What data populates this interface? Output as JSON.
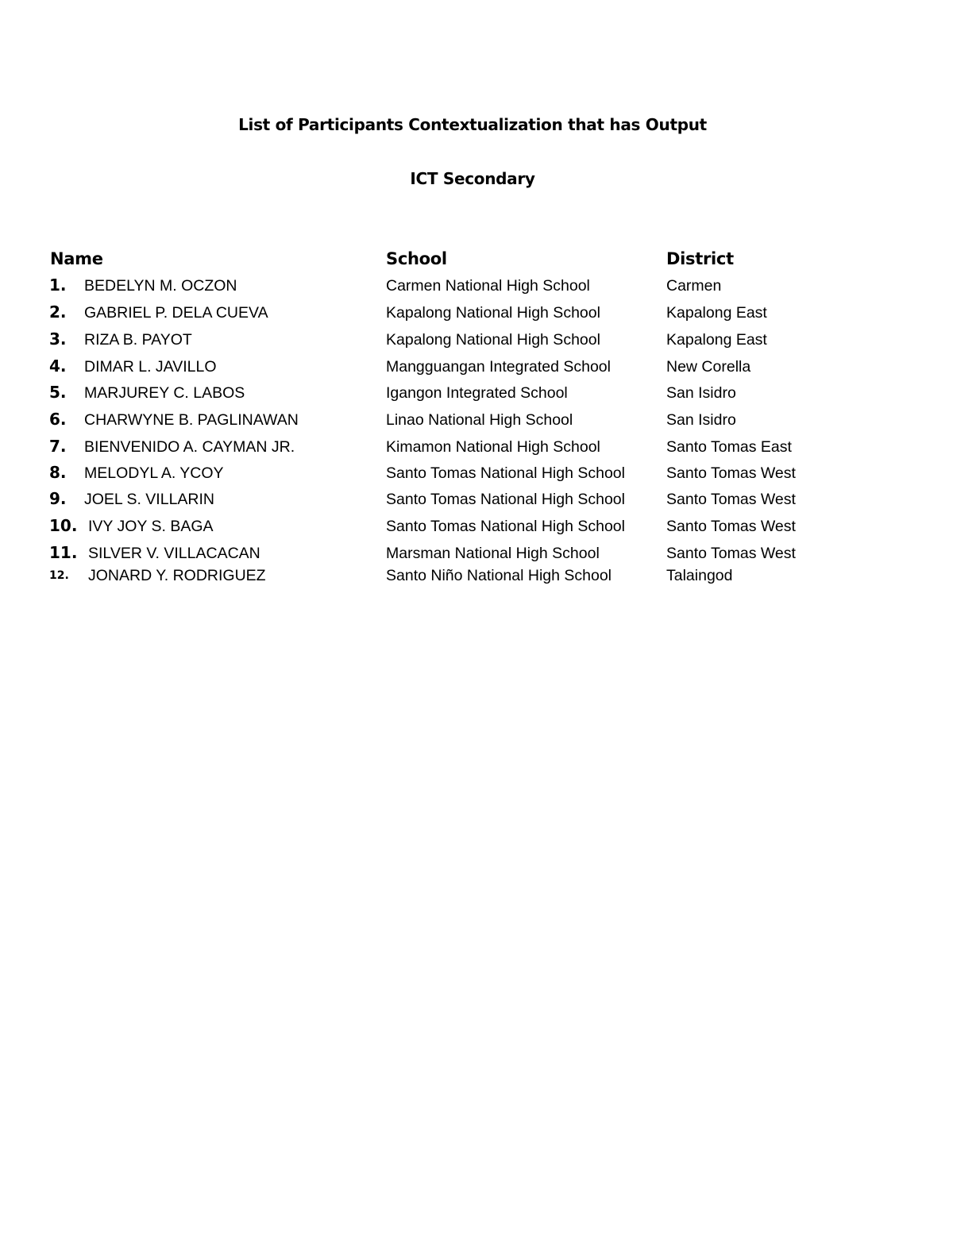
{
  "document": {
    "title": "List of Participants Contextualization that has Output",
    "subtitle": "ICT Secondary"
  },
  "table": {
    "columns": {
      "name": "Name",
      "school": "School",
      "district": "District"
    },
    "rows": [
      {
        "number": "1.",
        "name": "BEDELYN M. OCZON",
        "school": "Carmen National High School",
        "district": "Carmen"
      },
      {
        "number": "2.",
        "name": "GABRIEL P. DELA CUEVA",
        "school": "Kapalong National High School",
        "district": "Kapalong East"
      },
      {
        "number": "3.",
        "name": "RIZA B. PAYOT",
        "school": "Kapalong National High School",
        "district": "Kapalong East"
      },
      {
        "number": "4.",
        "name": "DIMAR L. JAVILLO",
        "school": "Mangguangan Integrated School",
        "district": "New Corella"
      },
      {
        "number": "5.",
        "name": "MARJUREY C. LABOS",
        "school": "Igangon Integrated School",
        "district": "San Isidro"
      },
      {
        "number": "6.",
        "name": "CHARWYNE B. PAGLINAWAN",
        "school": "Linao National High School",
        "district": "San Isidro"
      },
      {
        "number": "7.",
        "name": "BIENVENIDO A. CAYMAN JR.",
        "school": "Kimamon National High School",
        "district": "Santo Tomas East"
      },
      {
        "number": "8.",
        "name": "MELODYL A. YCOY",
        "school": "Santo Tomas National High School",
        "district": "Santo Tomas West"
      },
      {
        "number": "9.",
        "name": "JOEL S. VILLARIN",
        "school": "Santo Tomas National High School",
        "district": "Santo Tomas West"
      },
      {
        "number": "10.",
        "name": "IVY JOY S. BAGA",
        "school": "Santo Tomas National High School",
        "district": "Santo Tomas West"
      },
      {
        "number": "11.",
        "name": "SILVER V. VILLACACAN",
        "school": "Marsman National High School",
        "district": "Santo Tomas West"
      },
      {
        "number": "12.",
        "name": "JONARD Y. RODRIGUEZ",
        "school": "Santo Niño National High School",
        "district": "Talaingod"
      }
    ]
  }
}
